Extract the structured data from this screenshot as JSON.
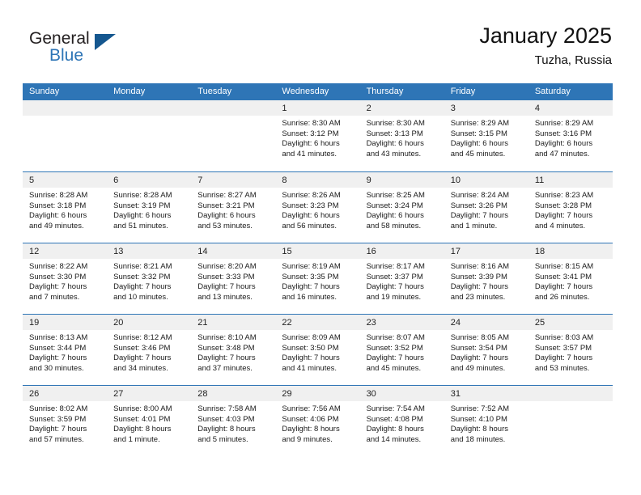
{
  "brand": {
    "name_part1": "General",
    "name_part2": "Blue",
    "triangle_icon": "triangle-icon"
  },
  "header": {
    "month_title": "January 2025",
    "location": "Tuzha, Russia"
  },
  "colors": {
    "header_blue": "#2e75b6",
    "logo_dark_blue": "#15578f",
    "day_band_gray": "#f0f0f0",
    "text": "#1a1a1a"
  },
  "calendar": {
    "weekdays": [
      "Sunday",
      "Monday",
      "Tuesday",
      "Wednesday",
      "Thursday",
      "Friday",
      "Saturday"
    ],
    "weeks": [
      [
        {
          "day": "",
          "empty": true,
          "lines": []
        },
        {
          "day": "",
          "empty": true,
          "lines": []
        },
        {
          "day": "",
          "empty": true,
          "lines": []
        },
        {
          "day": "1",
          "empty": false,
          "lines": [
            "Sunrise: 8:30 AM",
            "Sunset: 3:12 PM",
            "Daylight: 6 hours",
            "and 41 minutes."
          ]
        },
        {
          "day": "2",
          "empty": false,
          "lines": [
            "Sunrise: 8:30 AM",
            "Sunset: 3:13 PM",
            "Daylight: 6 hours",
            "and 43 minutes."
          ]
        },
        {
          "day": "3",
          "empty": false,
          "lines": [
            "Sunrise: 8:29 AM",
            "Sunset: 3:15 PM",
            "Daylight: 6 hours",
            "and 45 minutes."
          ]
        },
        {
          "day": "4",
          "empty": false,
          "lines": [
            "Sunrise: 8:29 AM",
            "Sunset: 3:16 PM",
            "Daylight: 6 hours",
            "and 47 minutes."
          ]
        }
      ],
      [
        {
          "day": "5",
          "empty": false,
          "lines": [
            "Sunrise: 8:28 AM",
            "Sunset: 3:18 PM",
            "Daylight: 6 hours",
            "and 49 minutes."
          ]
        },
        {
          "day": "6",
          "empty": false,
          "lines": [
            "Sunrise: 8:28 AM",
            "Sunset: 3:19 PM",
            "Daylight: 6 hours",
            "and 51 minutes."
          ]
        },
        {
          "day": "7",
          "empty": false,
          "lines": [
            "Sunrise: 8:27 AM",
            "Sunset: 3:21 PM",
            "Daylight: 6 hours",
            "and 53 minutes."
          ]
        },
        {
          "day": "8",
          "empty": false,
          "lines": [
            "Sunrise: 8:26 AM",
            "Sunset: 3:23 PM",
            "Daylight: 6 hours",
            "and 56 minutes."
          ]
        },
        {
          "day": "9",
          "empty": false,
          "lines": [
            "Sunrise: 8:25 AM",
            "Sunset: 3:24 PM",
            "Daylight: 6 hours",
            "and 58 minutes."
          ]
        },
        {
          "day": "10",
          "empty": false,
          "lines": [
            "Sunrise: 8:24 AM",
            "Sunset: 3:26 PM",
            "Daylight: 7 hours",
            "and 1 minute."
          ]
        },
        {
          "day": "11",
          "empty": false,
          "lines": [
            "Sunrise: 8:23 AM",
            "Sunset: 3:28 PM",
            "Daylight: 7 hours",
            "and 4 minutes."
          ]
        }
      ],
      [
        {
          "day": "12",
          "empty": false,
          "lines": [
            "Sunrise: 8:22 AM",
            "Sunset: 3:30 PM",
            "Daylight: 7 hours",
            "and 7 minutes."
          ]
        },
        {
          "day": "13",
          "empty": false,
          "lines": [
            "Sunrise: 8:21 AM",
            "Sunset: 3:32 PM",
            "Daylight: 7 hours",
            "and 10 minutes."
          ]
        },
        {
          "day": "14",
          "empty": false,
          "lines": [
            "Sunrise: 8:20 AM",
            "Sunset: 3:33 PM",
            "Daylight: 7 hours",
            "and 13 minutes."
          ]
        },
        {
          "day": "15",
          "empty": false,
          "lines": [
            "Sunrise: 8:19 AM",
            "Sunset: 3:35 PM",
            "Daylight: 7 hours",
            "and 16 minutes."
          ]
        },
        {
          "day": "16",
          "empty": false,
          "lines": [
            "Sunrise: 8:17 AM",
            "Sunset: 3:37 PM",
            "Daylight: 7 hours",
            "and 19 minutes."
          ]
        },
        {
          "day": "17",
          "empty": false,
          "lines": [
            "Sunrise: 8:16 AM",
            "Sunset: 3:39 PM",
            "Daylight: 7 hours",
            "and 23 minutes."
          ]
        },
        {
          "day": "18",
          "empty": false,
          "lines": [
            "Sunrise: 8:15 AM",
            "Sunset: 3:41 PM",
            "Daylight: 7 hours",
            "and 26 minutes."
          ]
        }
      ],
      [
        {
          "day": "19",
          "empty": false,
          "lines": [
            "Sunrise: 8:13 AM",
            "Sunset: 3:44 PM",
            "Daylight: 7 hours",
            "and 30 minutes."
          ]
        },
        {
          "day": "20",
          "empty": false,
          "lines": [
            "Sunrise: 8:12 AM",
            "Sunset: 3:46 PM",
            "Daylight: 7 hours",
            "and 34 minutes."
          ]
        },
        {
          "day": "21",
          "empty": false,
          "lines": [
            "Sunrise: 8:10 AM",
            "Sunset: 3:48 PM",
            "Daylight: 7 hours",
            "and 37 minutes."
          ]
        },
        {
          "day": "22",
          "empty": false,
          "lines": [
            "Sunrise: 8:09 AM",
            "Sunset: 3:50 PM",
            "Daylight: 7 hours",
            "and 41 minutes."
          ]
        },
        {
          "day": "23",
          "empty": false,
          "lines": [
            "Sunrise: 8:07 AM",
            "Sunset: 3:52 PM",
            "Daylight: 7 hours",
            "and 45 minutes."
          ]
        },
        {
          "day": "24",
          "empty": false,
          "lines": [
            "Sunrise: 8:05 AM",
            "Sunset: 3:54 PM",
            "Daylight: 7 hours",
            "and 49 minutes."
          ]
        },
        {
          "day": "25",
          "empty": false,
          "lines": [
            "Sunrise: 8:03 AM",
            "Sunset: 3:57 PM",
            "Daylight: 7 hours",
            "and 53 minutes."
          ]
        }
      ],
      [
        {
          "day": "26",
          "empty": false,
          "lines": [
            "Sunrise: 8:02 AM",
            "Sunset: 3:59 PM",
            "Daylight: 7 hours",
            "and 57 minutes."
          ]
        },
        {
          "day": "27",
          "empty": false,
          "lines": [
            "Sunrise: 8:00 AM",
            "Sunset: 4:01 PM",
            "Daylight: 8 hours",
            "and 1 minute."
          ]
        },
        {
          "day": "28",
          "empty": false,
          "lines": [
            "Sunrise: 7:58 AM",
            "Sunset: 4:03 PM",
            "Daylight: 8 hours",
            "and 5 minutes."
          ]
        },
        {
          "day": "29",
          "empty": false,
          "lines": [
            "Sunrise: 7:56 AM",
            "Sunset: 4:06 PM",
            "Daylight: 8 hours",
            "and 9 minutes."
          ]
        },
        {
          "day": "30",
          "empty": false,
          "lines": [
            "Sunrise: 7:54 AM",
            "Sunset: 4:08 PM",
            "Daylight: 8 hours",
            "and 14 minutes."
          ]
        },
        {
          "day": "31",
          "empty": false,
          "lines": [
            "Sunrise: 7:52 AM",
            "Sunset: 4:10 PM",
            "Daylight: 8 hours",
            "and 18 minutes."
          ]
        },
        {
          "day": "",
          "empty": true,
          "lines": []
        }
      ]
    ]
  }
}
